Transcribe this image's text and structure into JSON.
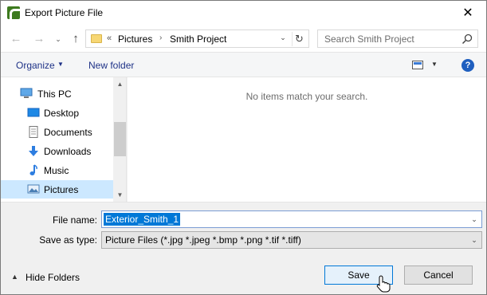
{
  "window": {
    "title": "Export Picture File",
    "close_glyph": "✕"
  },
  "navigation": {
    "back_glyph": "←",
    "forward_glyph": "→",
    "recent_glyph": "⌄",
    "up_glyph": "↑"
  },
  "address_bar": {
    "overflow": "«",
    "breadcrumbs": [
      "Pictures",
      "Smith Project"
    ],
    "separator": "›",
    "dropdown_glyph": "⌄",
    "refresh_glyph": "↻"
  },
  "search": {
    "placeholder": "Search Smith Project"
  },
  "toolbar": {
    "organize_label": "Organize",
    "organize_caret": "▼",
    "new_folder_label": "New folder",
    "view_caret": "▼",
    "help_glyph": "?"
  },
  "nav_pane": {
    "items": [
      {
        "label": "This PC",
        "icon": "computer-icon"
      },
      {
        "label": "Desktop",
        "icon": "desktop-icon"
      },
      {
        "label": "Documents",
        "icon": "documents-icon"
      },
      {
        "label": "Downloads",
        "icon": "downloads-icon"
      },
      {
        "label": "Music",
        "icon": "music-icon"
      },
      {
        "label": "Pictures",
        "icon": "pictures-icon",
        "selected": true
      }
    ],
    "scroll_up_glyph": "▲",
    "scroll_down_glyph": "▼"
  },
  "content": {
    "empty_message": "No items match your search."
  },
  "form": {
    "file_name_label": "File name:",
    "file_name_value": "Exterior_Smith_1",
    "save_as_type_label": "Save as type:",
    "save_as_type_value": "Picture Files (*.jpg *.jpeg *.bmp *.png *.tif *.tiff)",
    "dropdown_glyph": "⌄"
  },
  "footer": {
    "hide_folders_caret": "▲",
    "hide_folders_label": "Hide Folders",
    "save_label": "Save",
    "cancel_label": "Cancel"
  },
  "colors": {
    "accent": "#0078d7",
    "selection": "#cce8ff",
    "link": "#1e3287"
  }
}
